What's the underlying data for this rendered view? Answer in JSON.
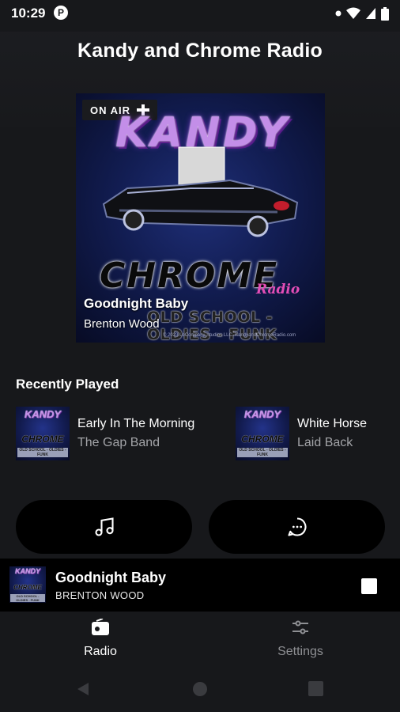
{
  "status_bar": {
    "time": "10:29",
    "app_icon": "app-notification-icon"
  },
  "app": {
    "title": "Kandy and Chrome Radio"
  },
  "now_playing": {
    "on_air_label": "ON AIR",
    "artwork": {
      "logo_top": "KANDY",
      "logo_bottom": "CHROME",
      "logo_script": "Radio",
      "genres": "OLD SCHOOL - OLDIES - FUNK",
      "credit": "© 2023 LoCompany Studios LLC.   KandyandChromeRadio.com"
    },
    "title": "Goodnight Baby",
    "artist": "Brenton Wood"
  },
  "recently_played": {
    "heading": "Recently Played",
    "items": [
      {
        "title": "Early In The Morning",
        "artist": "The Gap Band",
        "thumb": {
          "top": "KANDY",
          "bottom": "CHROME",
          "genres": "OLD SCHOOL - OLDIES - FUNK"
        }
      },
      {
        "title": "White Horse",
        "artist": "Laid Back",
        "thumb": {
          "top": "KANDY",
          "bottom": "CHROME",
          "genres": "OLD SCHOOL - OLDIES - FUNK"
        }
      }
    ]
  },
  "actions": {
    "music_icon": "music-note-icon",
    "chat_icon": "chat-bubble-icon"
  },
  "mini_player": {
    "title": "Goodnight Baby",
    "artist": "BRENTON WOOD",
    "thumb": {
      "top": "KANDY",
      "bottom": "CHROME",
      "genres": "OLD SCHOOL - OLDIES - FUNK"
    }
  },
  "bottom_nav": {
    "items": [
      {
        "label": "Radio",
        "icon": "radio-icon",
        "active": true
      },
      {
        "label": "Settings",
        "icon": "sliders-icon",
        "active": false
      }
    ]
  },
  "colors": {
    "background": "#17181b",
    "panel": "#000000",
    "text_muted": "#a3a4a8",
    "inactive_nav": "#8e8f93"
  }
}
